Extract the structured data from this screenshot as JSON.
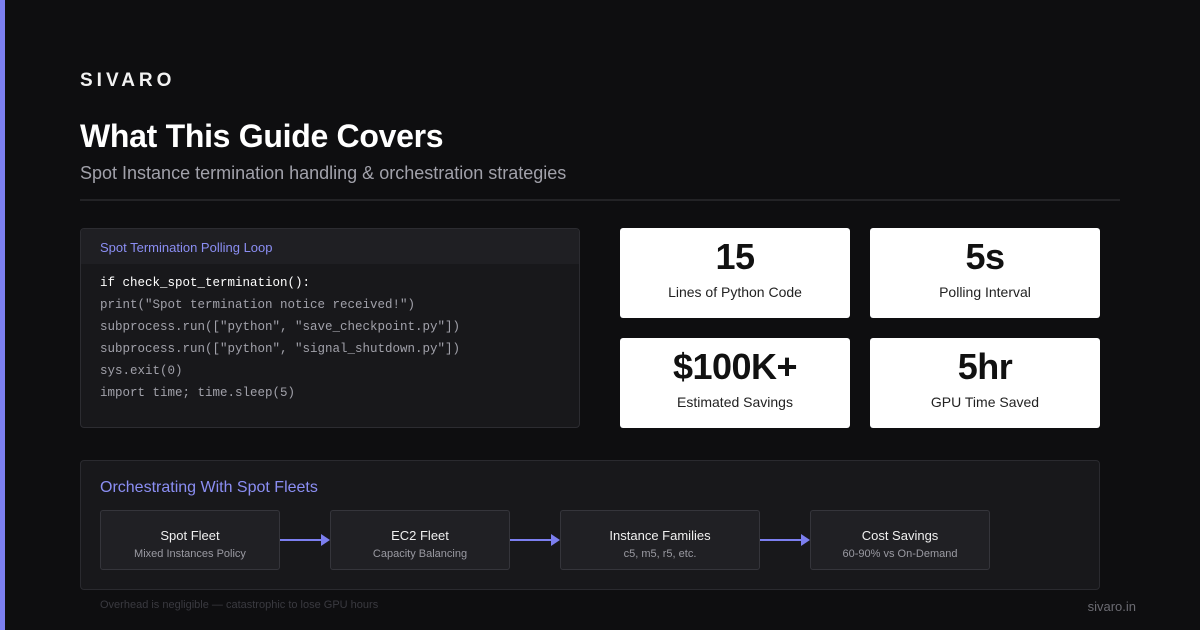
{
  "brand": "SIVARO",
  "title": "What This Guide Covers",
  "subtitle": "Spot Instance termination handling & orchestration strategies",
  "code_panel": {
    "title": "Spot Termination Polling Loop",
    "lines": [
      "if check_spot_termination():",
      "print(\"Spot termination notice received!\")",
      "subprocess.run([\"python\", \"save_checkpoint.py\"])",
      "subprocess.run([\"python\", \"signal_shutdown.py\"])",
      "sys.exit(0)",
      "import time; time.sleep(5)"
    ]
  },
  "stats": [
    {
      "value": "15",
      "label": "Lines of Python Code"
    },
    {
      "value": "5s",
      "label": "Polling Interval"
    },
    {
      "value": "$100K+",
      "label": "Estimated Savings"
    },
    {
      "value": "5hr",
      "label": "GPU Time Saved"
    }
  ],
  "orchestration": {
    "title": "Orchestrating With Spot Fleets",
    "nodes": [
      {
        "title": "Spot Fleet",
        "subtitle": "Mixed Instances Policy"
      },
      {
        "title": "EC2 Fleet",
        "subtitle": "Capacity Balancing"
      },
      {
        "title": "Instance Families",
        "subtitle": "c5, m5, r5, etc."
      },
      {
        "title": "Cost Savings",
        "subtitle": "60-90% vs On-Demand"
      }
    ]
  },
  "footnote": "Overhead is negligible — catastrophic to lose GPU hours",
  "footer_url": "sivaro.in",
  "colors": {
    "accent": "#7c7ff0",
    "background": "#0e0e10",
    "panel": "#18181b",
    "card": "#ffffff"
  }
}
